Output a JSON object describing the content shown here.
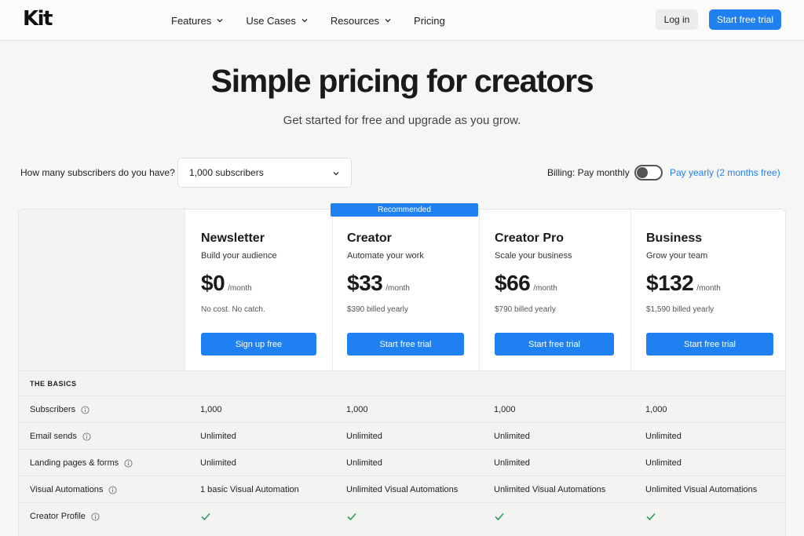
{
  "nav": {
    "logo": "Kit",
    "links": [
      {
        "label": "Features",
        "dropdown": true
      },
      {
        "label": "Use Cases",
        "dropdown": true
      },
      {
        "label": "Resources",
        "dropdown": true
      },
      {
        "label": "Pricing",
        "dropdown": false
      }
    ],
    "login_label": "Log in",
    "trial_label": "Start free trial"
  },
  "hero": {
    "title": "Simple pricing for creators",
    "subtitle": "Get started for free and upgrade as you grow."
  },
  "controls": {
    "subscribers_question": "How many subscribers do you have?",
    "subscribers_selected": "1,000 subscribers",
    "billing_label": "Billing: Pay monthly",
    "yearly_label": "Pay yearly (2 months free)"
  },
  "recommended_label": "Recommended",
  "plans": [
    {
      "name": "Newsletter",
      "tagline": "Build your audience",
      "price": "$0",
      "period": "/month",
      "note": "No cost. No catch.",
      "cta": "Sign up free"
    },
    {
      "name": "Creator",
      "tagline": "Automate your work",
      "price": "$33",
      "period": "/month",
      "note": "$390 billed yearly",
      "cta": "Start free trial"
    },
    {
      "name": "Creator Pro",
      "tagline": "Scale your business",
      "price": "$66",
      "period": "/month",
      "note": "$790 billed yearly",
      "cta": "Start free trial"
    },
    {
      "name": "Business",
      "tagline": "Grow your team",
      "price": "$132",
      "period": "/month",
      "note": "$1,590 billed yearly",
      "cta": "Start free trial"
    }
  ],
  "section_title": "THE BASICS",
  "features": [
    {
      "label": "Subscribers",
      "values": [
        "1,000",
        "1,000",
        "1,000",
        "1,000"
      ]
    },
    {
      "label": "Email sends",
      "values": [
        "Unlimited",
        "Unlimited",
        "Unlimited",
        "Unlimited"
      ]
    },
    {
      "label": "Landing pages & forms",
      "values": [
        "Unlimited",
        "Unlimited",
        "Unlimited",
        "Unlimited"
      ]
    },
    {
      "label": "Visual Automations",
      "values": [
        "1 basic Visual Automation",
        "Unlimited Visual Automations",
        "Unlimited Visual Automations",
        "Unlimited Visual Automations"
      ]
    },
    {
      "label": "Creator Profile",
      "values": [
        "check",
        "check",
        "check",
        "check"
      ]
    }
  ],
  "colors": {
    "accent": "#1f80f2",
    "check": "#2e9e5b"
  }
}
